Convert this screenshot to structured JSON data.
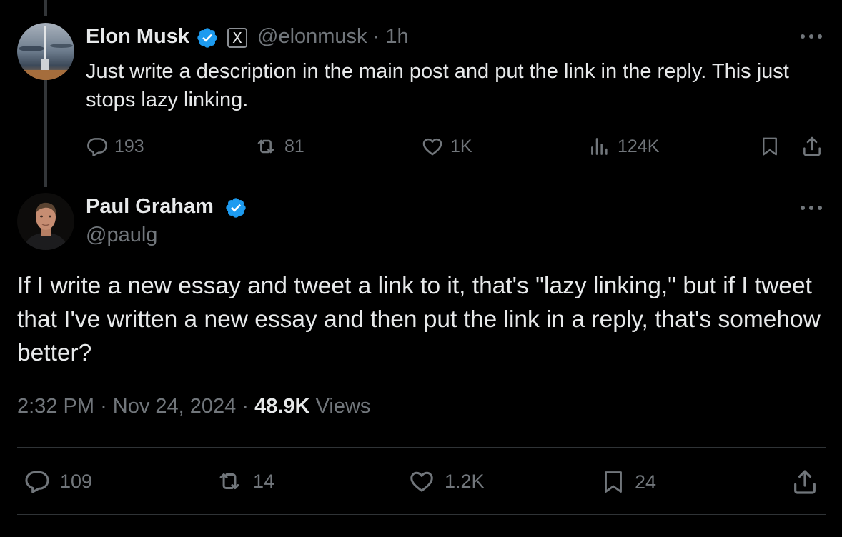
{
  "reply_tweet": {
    "author_name": "Elon Musk",
    "handle": "@elonmusk",
    "separator": "·",
    "time_ago": "1h",
    "affiliate_badge": "X",
    "text": "Just write a description in the main post and put the link in the reply. This just stops lazy linking.",
    "stats": {
      "replies": "193",
      "reposts": "81",
      "likes": "1K",
      "views": "124K"
    }
  },
  "main_tweet": {
    "author_name": "Paul Graham",
    "handle": "@paulg",
    "text": "If I write a new essay and tweet a link to it, that's \"lazy linking,\" but if I tweet that I've written a new essay and then put the link in a reply, that's somehow better?",
    "time": "2:32 PM",
    "date": "Nov 24, 2024",
    "separator": "·",
    "views_count": "48.9K",
    "views_label": "Views",
    "stats": {
      "replies": "109",
      "reposts": "14",
      "likes": "1.2K",
      "bookmarks": "24"
    }
  },
  "icons": {
    "verified": "verified-badge-icon",
    "more": "more-icon",
    "reply": "reply-icon",
    "repost": "repost-icon",
    "like": "like-icon",
    "views": "views-icon",
    "bookmark": "bookmark-icon",
    "share": "share-icon"
  },
  "colors": {
    "background": "#000000",
    "text_primary": "#e7e9ea",
    "text_secondary": "#71767b",
    "verified_blue": "#1d9bf0",
    "divider": "#2f3336"
  }
}
